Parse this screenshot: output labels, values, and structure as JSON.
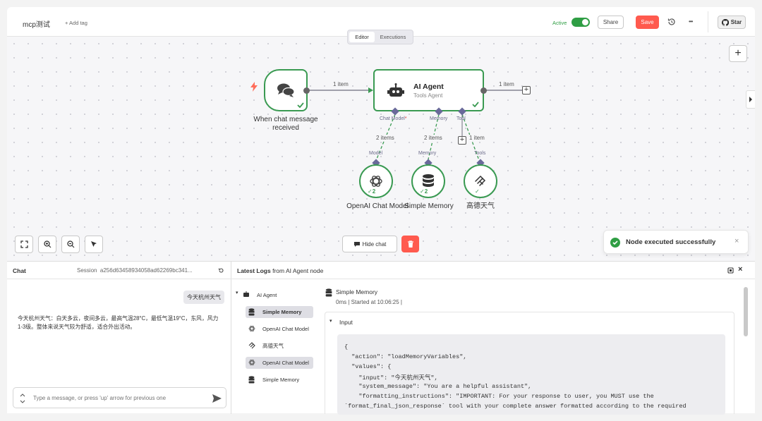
{
  "header": {
    "title": "mcp测试",
    "add_tag": "+ Add tag",
    "active_label": "Active",
    "share_label": "Share",
    "save_label": "Save",
    "star_label": "Star",
    "more_label": "•••"
  },
  "tabs": [
    {
      "label": "Editor",
      "active": true
    },
    {
      "label": "Executions",
      "active": false
    }
  ],
  "canvas": {
    "trigger": {
      "label_line1": "When chat message",
      "label_line2": "received"
    },
    "agent": {
      "title": "AI Agent",
      "subtitle": "Tools Agent"
    },
    "edge1_label": "1 item",
    "edge2_label": "1 item",
    "ports": {
      "chat_model": "Chat Model",
      "required_mark": "*",
      "memory": "Memory",
      "tool": "Tool"
    },
    "sub_edges": {
      "model_count": "2 items",
      "memory_count": "2 items",
      "tool_count": "1 item"
    },
    "sub_ports": {
      "model": "Model",
      "memory": "Memory",
      "tools": "Tools"
    },
    "subnodes": [
      {
        "label": "OpenAI Chat Model",
        "badge": "2"
      },
      {
        "label": "Simple Memory",
        "badge": "2"
      },
      {
        "label": "高德天气",
        "badge": ""
      }
    ],
    "hide_chat_label": "Hide chat",
    "toast": "Node executed successfully"
  },
  "chat": {
    "title": "Chat",
    "session": "Session  a256d63458934058ad62269bc341...",
    "user_message": "今天杭州天气",
    "bot_message": "今天杭州天气：白天多云，夜间多云，最高气温28°C，最低气温19°C，东风，风力1-3级。整体来说天气较为舒适，适合外出活动。",
    "input_placeholder": "Type a message, or press 'up' arrow for previous one"
  },
  "logs": {
    "title_bold": "Latest Logs",
    "title_rest": " from AI Agent node",
    "tree": [
      {
        "label": "AI Agent",
        "selected": false
      },
      {
        "label": "Simple Memory",
        "selected": true
      },
      {
        "label": "OpenAI Chat Model",
        "selected": false
      },
      {
        "label": "高德天气",
        "selected": false
      },
      {
        "label": "OpenAI Chat Model",
        "selected": false
      },
      {
        "label": "Simple Memory",
        "selected": false
      }
    ],
    "detail_title": "Simple Memory",
    "detail_meta": "0ms | Started at 10:06:25 |",
    "input_section": "Input",
    "code": [
      "{",
      "  \"action\": \"loadMemoryVariables\",",
      "  \"values\": {",
      "    \"input\": \"今天杭州天气\",",
      "    \"system_message\": \"You are a helpful assistant\",",
      "    \"formatting_instructions\": \"IMPORTANT: For your response to user, you MUST use the",
      "`format_final_json_response` tool with your complete answer formatted according to the required"
    ]
  },
  "colors": {
    "accent_green": "#2f9e44",
    "save_red": "#ff5a4e",
    "node_border": "#3a9a52",
    "port_purple": "#6a6a9a",
    "trigger_orange": "#ff6d5a"
  }
}
